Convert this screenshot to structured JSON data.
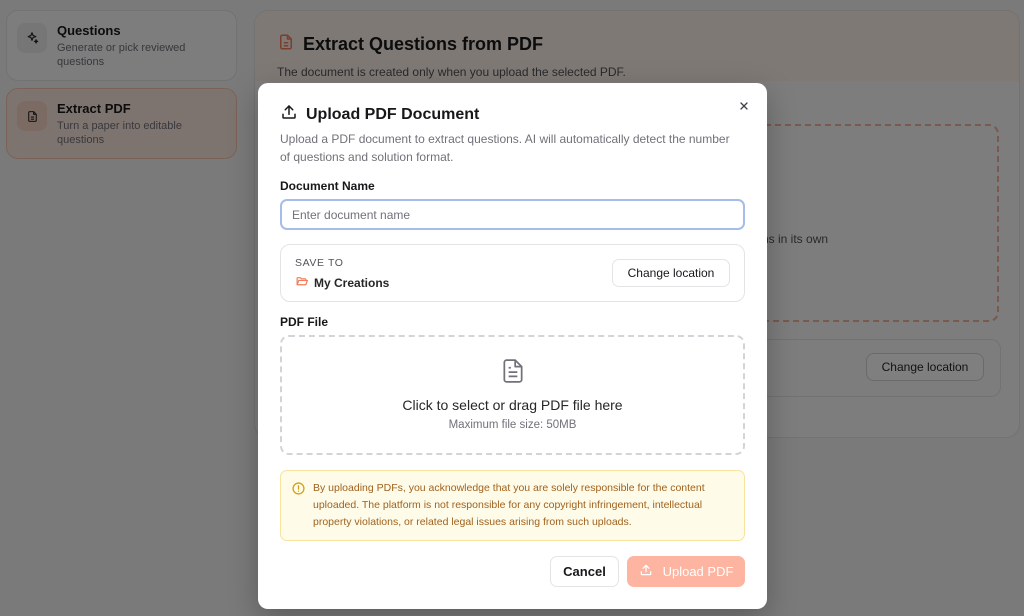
{
  "sidebar": {
    "items": [
      {
        "title": "Questions",
        "subtitle": "Generate or pick reviewed questions",
        "icon": "sparkle-icon"
      },
      {
        "title": "Extract PDF",
        "subtitle": "Turn a paper into editable questions",
        "icon": "document-icon"
      }
    ]
  },
  "main": {
    "title": "Extract Questions from PDF",
    "description": "The document is created only when you upload the selected PDF.",
    "bg_drop_text": "ns in its own",
    "change_location_label": "Change location"
  },
  "modal": {
    "title": "Upload PDF Document",
    "description": "Upload a PDF document to extract questions. AI will automatically detect the number of questions and solution format.",
    "doc_name_label": "Document Name",
    "doc_name_placeholder": "Enter document name",
    "doc_name_value": "",
    "save_to_label": "SAVE TO",
    "location": "My Creations",
    "change_location_label": "Change location",
    "pdf_file_label": "PDF File",
    "drop_main": "Click to select or drag PDF file here",
    "drop_sub": "Maximum file size: 50MB",
    "warning": "By uploading PDFs, you acknowledge that you are solely responsible for the content uploaded. The platform is not responsible for any copyright infringement, intellectual property violations, or related legal issues arising from such uploads.",
    "cancel_label": "Cancel",
    "upload_label": "Upload PDF"
  },
  "colors": {
    "accent": "#f47c5a",
    "upload_disabled": "#fdb4a0",
    "warning_bg": "#fefbe8",
    "warning_text": "#a1621e",
    "overlay": "rgba(0,0,0,0.5)"
  }
}
